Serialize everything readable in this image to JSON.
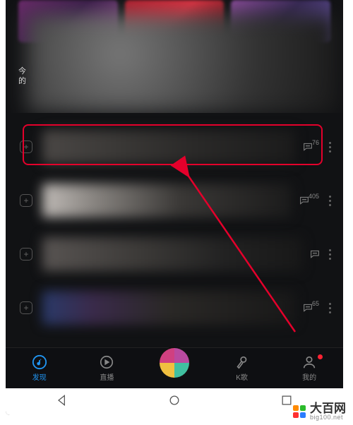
{
  "banner": {
    "corner_text": "今\n的"
  },
  "list": {
    "rows": [
      {
        "comment_count": "76",
        "highlighted": true
      },
      {
        "comment_count": "405",
        "highlighted": false
      },
      {
        "comment_count": "",
        "highlighted": false
      },
      {
        "comment_count": "65",
        "highlighted": false
      }
    ]
  },
  "tabs": {
    "discover": "发现",
    "live": "直播",
    "ktv": "K歌",
    "mine": "我的"
  },
  "colors": {
    "accent": "#2196f3",
    "highlight": "#e4002b"
  },
  "watermark": {
    "cn": "大百网",
    "en": "big100.net"
  }
}
